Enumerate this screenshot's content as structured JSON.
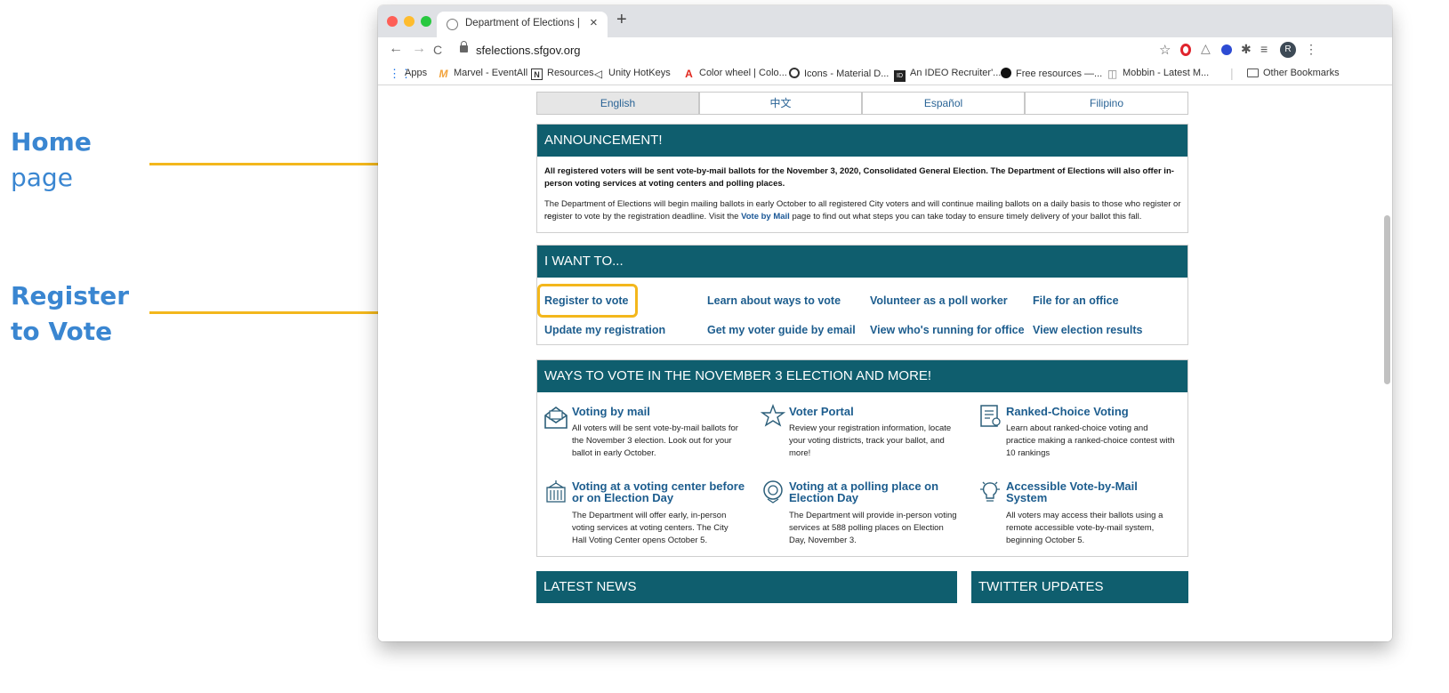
{
  "annotations": [
    {
      "bold": "Home",
      "normal": "page"
    },
    {
      "bold": "Register",
      "normal": "to Vote"
    }
  ],
  "browser": {
    "tab_title": "Department of Elections |",
    "tab_close": "×",
    "new_tab": "+",
    "back": "←",
    "forward": "→",
    "reload": "C",
    "url": "sfelections.sfgov.org",
    "star": "☆",
    "profile_initial": "R",
    "menu": "⋮",
    "bookmarks": [
      {
        "label": "Apps",
        "icon": "apps-icon"
      },
      {
        "label": "Marvel - EventAll",
        "icon": "marvel-icon"
      },
      {
        "label": "Resources",
        "icon": "notion-icon"
      },
      {
        "label": "Unity HotKeys",
        "icon": "unity-icon"
      },
      {
        "label": "Color wheel | Colo...",
        "icon": "adobe-icon"
      },
      {
        "label": "Icons - Material D...",
        "icon": "material-icon"
      },
      {
        "label": "An IDEO Recruiter'...",
        "icon": "ideo-icon"
      },
      {
        "label": "Free resources —...",
        "icon": "circle-icon"
      },
      {
        "label": "Mobbin - Latest M...",
        "icon": "mobbin-icon"
      }
    ],
    "other_bookmarks": "Other Bookmarks"
  },
  "languages": [
    {
      "label": "English",
      "active": true
    },
    {
      "label": "中文",
      "active": false
    },
    {
      "label": "Español",
      "active": false
    },
    {
      "label": "Filipino",
      "active": false
    }
  ],
  "announcement": {
    "heading": "ANNOUNCEMENT!",
    "bold_line_1": "All registered voters will be sent vote-by-mail ballots for the November 3, 2020, Consolidated General Election. The Department of Elections will also offer in-",
    "bold_line_2": "person voting services at voting centers and polling places.",
    "body_line_1": "The Department of Elections will begin mailing ballots in early October to all registered City voters and will continue mailing ballots on a daily basis to those who register or re-",
    "body_line_2_pre": "register to vote by the registration deadline. Visit the ",
    "body_link": "Vote by Mail",
    "body_line_2_post": " page to find out what steps you can take today to ensure timely delivery of your ballot this fall."
  },
  "i_want_to": {
    "heading": "I WANT TO...",
    "links": [
      "Register to vote",
      "Learn about ways to vote",
      "Volunteer as a poll worker",
      "File for an office",
      "Update my registration",
      "Get my voter guide by email",
      "View who's running for office",
      "View election results"
    ]
  },
  "ways": {
    "heading": "WAYS TO VOTE IN THE NOVEMBER 3 ELECTION AND MORE!",
    "items": [
      {
        "icon": "envelope-icon",
        "title_1": "Voting by mail",
        "title_2": "",
        "desc": [
          "All voters will be sent vote-by-mail ballots for",
          "the November 3 election. Look out for your",
          "ballot in early October."
        ]
      },
      {
        "icon": "star-icon",
        "title_1": "Voter Portal",
        "title_2": "",
        "desc": [
          "Review your registration information, locate",
          "your voting districts, track your ballot, and",
          "more!"
        ]
      },
      {
        "icon": "clipboard-icon",
        "title_1": "Ranked-Choice Voting",
        "title_2": "",
        "desc": [
          "Learn about ranked-choice voting and",
          "practice making a ranked-choice contest with",
          "10 rankings"
        ]
      },
      {
        "icon": "building-icon",
        "title_1": "Voting at a voting center before",
        "title_2": "or on Election Day",
        "desc": [
          "The Department will offer early, in-person",
          "voting services at voting centers. The City",
          "Hall Voting Center opens October 5."
        ]
      },
      {
        "icon": "location-icon",
        "title_1": "Voting at a polling place on",
        "title_2": "Election Day",
        "desc": [
          "The Department will provide in-person voting",
          "services at 588 polling places on Election",
          "Day, November 3."
        ]
      },
      {
        "icon": "lightbulb-icon",
        "title_1": "Accessible Vote-by-Mail",
        "title_2": "System",
        "desc": [
          "All voters may access their ballots using a",
          "remote accessible vote-by-mail system,",
          "beginning October 5."
        ]
      }
    ]
  },
  "latest_news": {
    "heading": "LATEST NEWS"
  },
  "twitter": {
    "heading": "TWITTER UPDATES"
  },
  "colors": {
    "header_teal": "#0f5e6e",
    "link_blue": "#1d5d8e",
    "highlight_yellow": "#f3b71c",
    "annotation_blue": "#3a86d1"
  }
}
